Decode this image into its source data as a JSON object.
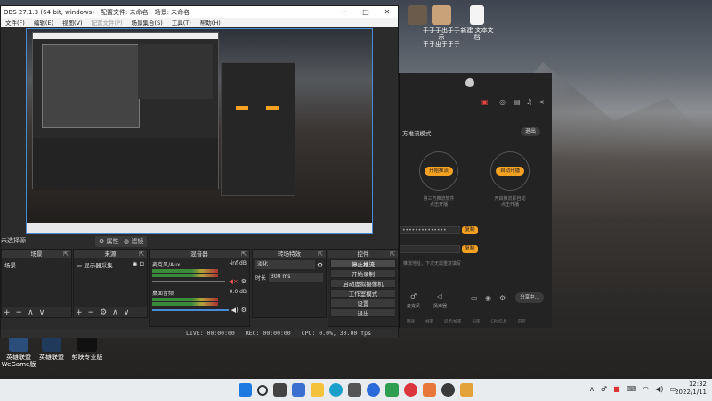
{
  "desktop": {
    "top_icons": [
      {
        "label": "",
        "color": "#6b5b4b"
      },
      {
        "label": "手手手出手手示\n手手出手手手",
        "color": "#c9a27a"
      },
      {
        "label": "新建 文本文\n档",
        "color": "#f4f4f4"
      }
    ],
    "left_icons": [
      {
        "label": "英雄联盟\nWeGame版",
        "color": "#2a4d7a"
      },
      {
        "label": "英雄联盟",
        "color": "#1f3a5a"
      },
      {
        "label": "剪映专业版",
        "color": "#111111"
      }
    ]
  },
  "obs": {
    "title": "OBS 27.1.3 (64-bit, windows) - 配置文件: 未命名 - 场景: 未命名",
    "window_buttons": [
      "─",
      "□",
      "✕"
    ],
    "menu": [
      "文件(F)",
      "编辑(E)",
      "视图(V)",
      "配置文件(P)",
      "场景集合(S)",
      "工具(T)",
      "帮助(H)"
    ],
    "no_source_selected": "未选择源",
    "properties_btn": "属性",
    "filters_btn": "滤镜",
    "docks": {
      "scenes": {
        "title": "场景",
        "item": "场景"
      },
      "sources": {
        "title": "来源",
        "item": "显示器采集"
      },
      "mixer": {
        "title": "混音器",
        "tracks": [
          {
            "name": "麦克风/Aux",
            "db": "-inf dB"
          },
          {
            "name": "桌面音频",
            "db": "0.0 dB"
          }
        ]
      },
      "transitions": {
        "title": "转场特效",
        "type": "淡化",
        "duration_label": "时长",
        "duration": "300 ms"
      },
      "controls": {
        "title": "控件",
        "buttons": [
          "停止推流",
          "开始录制",
          "启动虚拟摄像机",
          "工作室模式",
          "设置",
          "退出"
        ]
      }
    },
    "status": {
      "live": "LIVE: 00:00:00",
      "rec": "REC: 00:00:00",
      "cpu": "CPU: 0.0%, 30.00 fps"
    }
  },
  "app": {
    "mode_title": "方推流模式",
    "exit_btn": "退出",
    "option1": {
      "btn": "开始推流",
      "desc": "第三方推流软件\n点击开播"
    },
    "option2": {
      "btn": "自动开播",
      "desc": "开启推流即自动\n点击开播"
    },
    "server_field": "••••••••••••••",
    "key_field": "",
    "copy_btn": "复制",
    "hint": "推流地址，下次无需重复填写",
    "bottom": {
      "mic": "麦克风",
      "speaker": "扬声器",
      "share": "分享中..."
    },
    "stats": [
      "网速",
      "帧率",
      "延迟/帧率",
      "码率",
      "CPU信息",
      "内存"
    ]
  },
  "taskbar": {
    "time": "12:32",
    "date": "2022/1/11",
    "apps": [
      {
        "name": "start",
        "color": "#1e7ae0"
      },
      {
        "name": "search",
        "color": "#333333"
      },
      {
        "name": "task-view",
        "color": "#444444"
      },
      {
        "name": "widgets",
        "color": "#3b6fd0"
      },
      {
        "name": "explorer",
        "color": "#f5c33b"
      },
      {
        "name": "edge",
        "color": "#1aa0c9"
      },
      {
        "name": "store",
        "color": "#555555"
      },
      {
        "name": "app-l",
        "color": "#2a6bd9"
      },
      {
        "name": "chat",
        "color": "#2f9e4f"
      },
      {
        "name": "app-red",
        "color": "#d9363e"
      },
      {
        "name": "app-orange",
        "color": "#e7773a"
      },
      {
        "name": "obs",
        "color": "#3a3a3a"
      },
      {
        "name": "app-yellow",
        "color": "#e3a23a"
      }
    ]
  }
}
